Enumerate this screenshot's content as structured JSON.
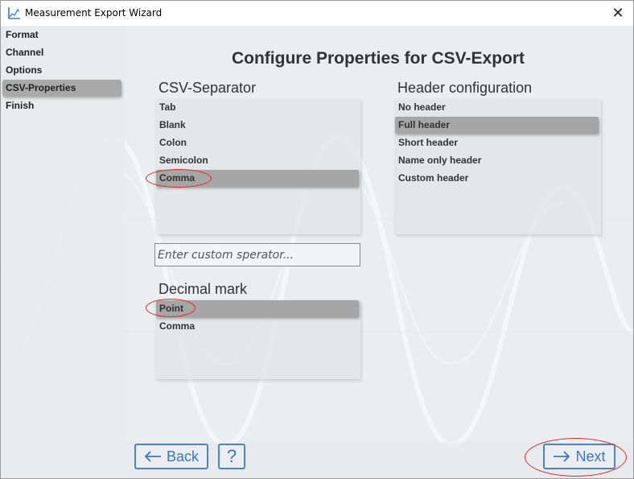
{
  "window": {
    "title": "Measurement Export Wizard",
    "close_icon": "close-icon",
    "app_icon": "chart-icon"
  },
  "sidebar": {
    "items": [
      {
        "label": "Format",
        "selected": false
      },
      {
        "label": "Channel",
        "selected": false
      },
      {
        "label": "Options",
        "selected": false
      },
      {
        "label": "CSV-Properties",
        "selected": true
      },
      {
        "label": "Finish",
        "selected": false
      }
    ]
  },
  "main": {
    "title": "Configure Properties for CSV-Export",
    "csv_separator": {
      "heading": "CSV-Separator",
      "options": [
        "Tab",
        "Blank",
        "Colon",
        "Semicolon",
        "Comma"
      ],
      "selected": "Comma",
      "custom_placeholder": "Enter custom sperator..."
    },
    "header_config": {
      "heading": "Header configuration",
      "options": [
        "No header",
        "Full header",
        "Short header",
        "Name only header",
        "Custom header"
      ],
      "selected": "Full header"
    },
    "decimal_mark": {
      "heading": "Decimal mark",
      "options": [
        "Point",
        "Comma"
      ],
      "selected": "Point"
    }
  },
  "footer": {
    "back_label": "Back",
    "back_icon": "arrow-left-icon",
    "help_label": "?",
    "next_label": "Next",
    "next_icon": "arrow-right-icon"
  },
  "colors": {
    "accent": "#3a74c4",
    "annotation": "#e0262a",
    "selection": "#a6a6a6"
  }
}
